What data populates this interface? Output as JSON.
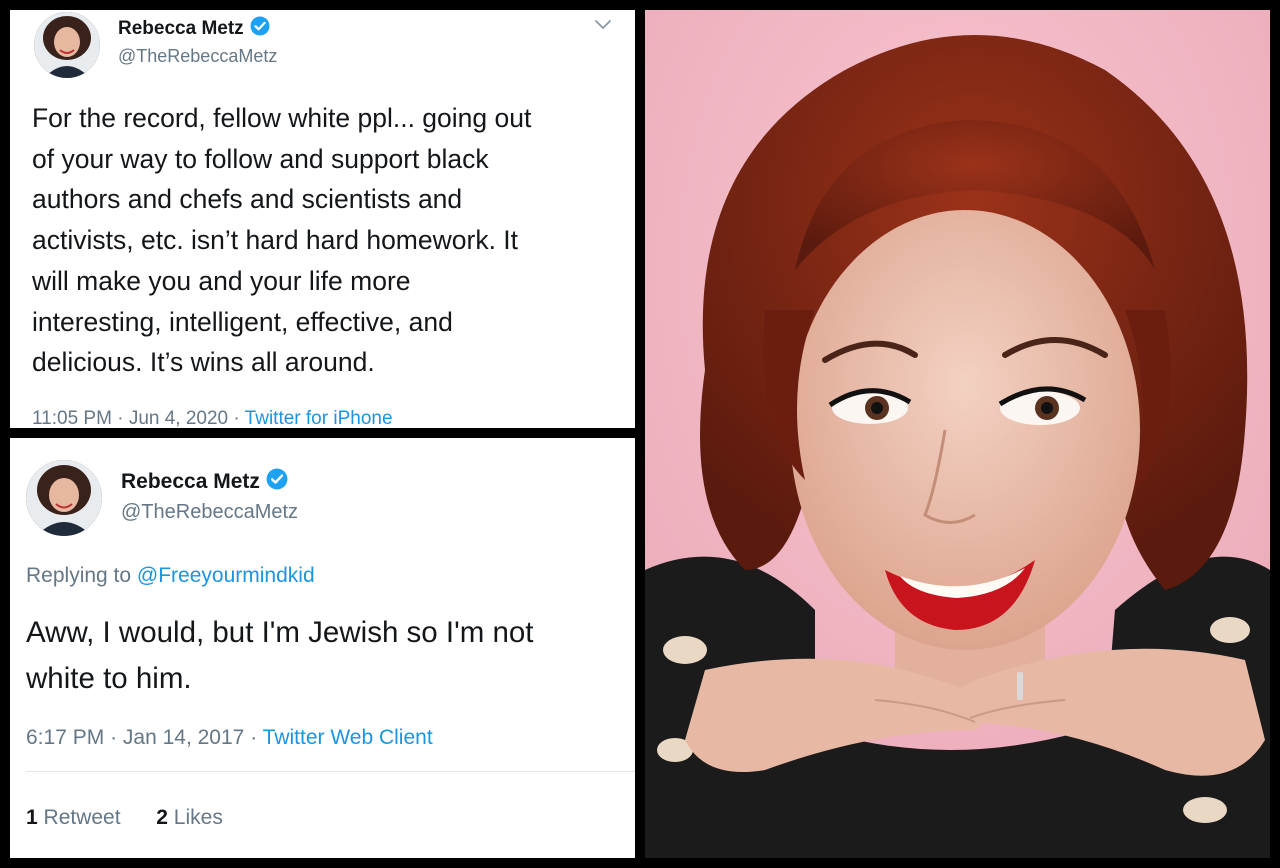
{
  "tweet1": {
    "name": "Rebecca Metz",
    "handle": "@TheRebeccaMetz",
    "text_lines": [
      "For the record, fellow white ppl... going out",
      "of your way to follow and support black",
      "authors and chefs and scientists and",
      "activists, etc. isn’t hard hard homework. It",
      "will make you and your life more",
      "interesting, intelligent, effective, and",
      "delicious. It’s wins all around."
    ],
    "time": "11:05 PM",
    "date": "Jun 4, 2020",
    "source": "Twitter for iPhone",
    "sep": "·"
  },
  "tweet2": {
    "name": "Rebecca Metz",
    "handle": "@TheRebeccaMetz",
    "replying_prefix": "Replying to ",
    "replying_to": "@Freeyourmindkid",
    "text_lines": [
      "Aww, I would, but I'm Jewish so I'm not",
      "white to him."
    ],
    "time": "6:17 PM",
    "date": "Jan 14, 2017",
    "source": "Twitter Web Client",
    "sep": "·",
    "retweets_count": "1",
    "retweets_label": "Retweet",
    "likes_count": "2",
    "likes_label": "Likes"
  },
  "colors": {
    "link": "#1b95e0",
    "muted": "#657786",
    "text": "#14171a",
    "photo_background": "#f2b3c1",
    "hair": "#7a2314",
    "lips": "#c8141c"
  },
  "icons": [
    "verified-badge-icon",
    "chevron-down-icon"
  ]
}
